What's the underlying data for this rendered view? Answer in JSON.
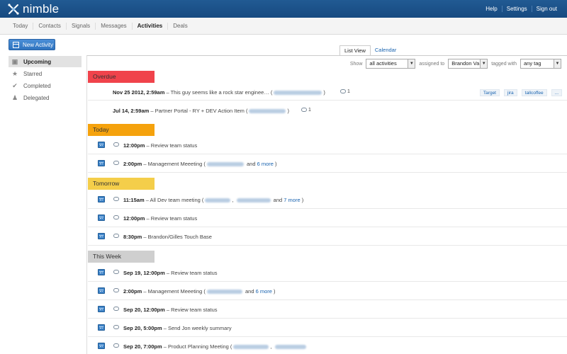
{
  "header": {
    "logo": "nimble",
    "links": [
      "Help",
      "Settings",
      "Sign out"
    ]
  },
  "nav": {
    "tabs": [
      "Today",
      "Contacts",
      "Signals",
      "Messages",
      "Activities",
      "Deals"
    ],
    "active": "Activities"
  },
  "new_activity": {
    "label": "New Activity"
  },
  "sidebar": {
    "items": [
      {
        "label": "Upcoming",
        "icon": "inbox-icon",
        "active": true
      },
      {
        "label": "Starred",
        "icon": "star-icon"
      },
      {
        "label": "Completed",
        "icon": "check-icon"
      },
      {
        "label": "Delegated",
        "icon": "people-icon"
      }
    ]
  },
  "view_tabs": {
    "list": "List View",
    "calendar": "Calendar"
  },
  "filters": {
    "show_label": "Show",
    "show_value": "all activities",
    "assigned_label": "assigned to",
    "assigned_value": "Brandon Va",
    "tagged_label": "tagged with",
    "tagged_value": "any tag"
  },
  "sections": {
    "overdue": "Overdue",
    "today": "Today",
    "tomorrow": "Tomorrow",
    "week": "This Week"
  },
  "overdue": [
    {
      "time": "Nov 25 2012, 2:59am",
      "text": " – This guy seems like a rock star enginee… (",
      "count": "1",
      "tags": [
        "Target",
        "jira",
        "tallcoffee",
        "..."
      ]
    },
    {
      "time": "Jul 14, 2:59am",
      "text": " – Partner Portal - RY + DEV Action Item (",
      "count": "1"
    }
  ],
  "today": [
    {
      "time": "12:00pm",
      "text": " – Review team status"
    },
    {
      "time": "2:00pm",
      "text": " – Management Meeeting (",
      "and": "and",
      "more": "6 more",
      "close": ")"
    }
  ],
  "tomorrow": [
    {
      "time": "11:15am",
      "text": " – All Dev team meeting (",
      "and": "and",
      "more": "7 more",
      "close": ")"
    },
    {
      "time": "12:00pm",
      "text": " – Review team status"
    },
    {
      "time": "8:30pm",
      "text": " – Brandon/Gilles Touch Base"
    }
  ],
  "week": [
    {
      "time": "Sep 19, 12:00pm",
      "text": " – Review team status"
    },
    {
      "time": "2:00pm",
      "text": " – Management Meeeting (",
      "and": "and",
      "more": "6 more",
      "close": ")"
    },
    {
      "time": "Sep 20, 12:00pm",
      "text": " – Review team status"
    },
    {
      "time": "Sep 20, 5:00pm",
      "text": " – Send Jon weekly summary"
    },
    {
      "time": "Sep 20, 7:00pm",
      "text": " – Product Planning Meeting ("
    }
  ]
}
